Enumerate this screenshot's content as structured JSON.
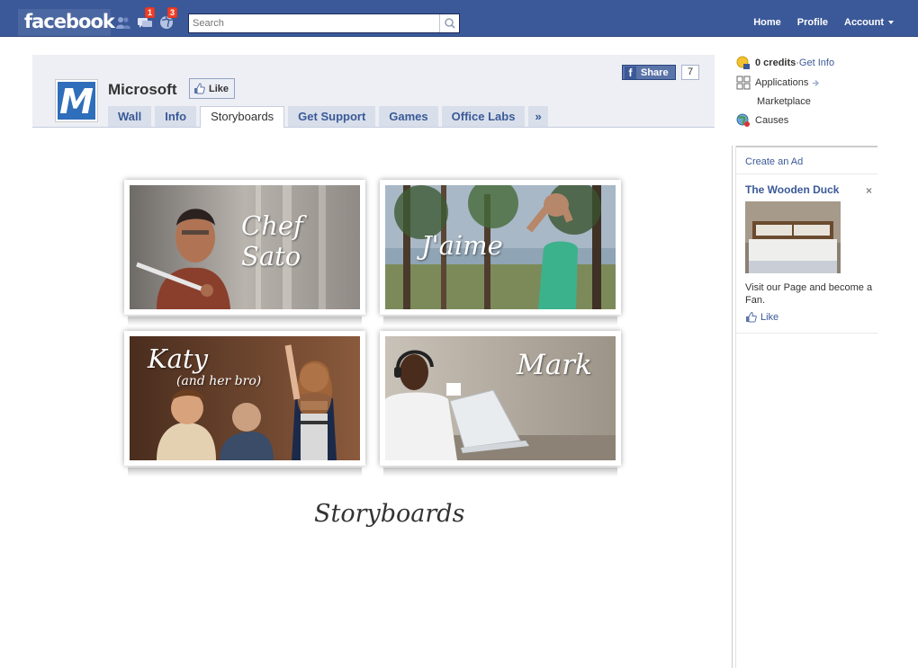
{
  "topbar": {
    "logo": "facebook",
    "badges": {
      "messages": "1",
      "notifications": "3"
    },
    "search_placeholder": "Search",
    "nav": {
      "home": "Home",
      "profile": "Profile",
      "account": "Account"
    }
  },
  "page": {
    "name": "Microsoft",
    "logo_letter": "M",
    "like_label": "Like",
    "share_label": "Share",
    "share_count": "7",
    "tabs": [
      "Wall",
      "Info",
      "Storyboards",
      "Get Support",
      "Games",
      "Office Labs"
    ],
    "more_tabs_glyph": "»",
    "active_tab": "Storyboards"
  },
  "storyboards": {
    "cards": [
      {
        "title": "Chef Sato",
        "subtitle": ""
      },
      {
        "title": "J'aime",
        "subtitle": ""
      },
      {
        "title": "Katy",
        "subtitle": "(and her bro)"
      },
      {
        "title": "Mark",
        "subtitle": ""
      }
    ],
    "caption": "Storyboards"
  },
  "sidebar": {
    "credits": "0 credits",
    "credits_sep": " · ",
    "get_info": "Get Info",
    "applications": "Applications",
    "marketplace": "Marketplace",
    "causes": "Causes"
  },
  "ad": {
    "create": "Create an Ad",
    "title": "The Wooden Duck",
    "close": "×",
    "text": "Visit our Page and become a Fan.",
    "like": "Like"
  },
  "colors": {
    "brand": "#3b5998",
    "badge": "#f03d25",
    "tab_bg": "#d8dfea",
    "header_bg": "#edeff4"
  }
}
